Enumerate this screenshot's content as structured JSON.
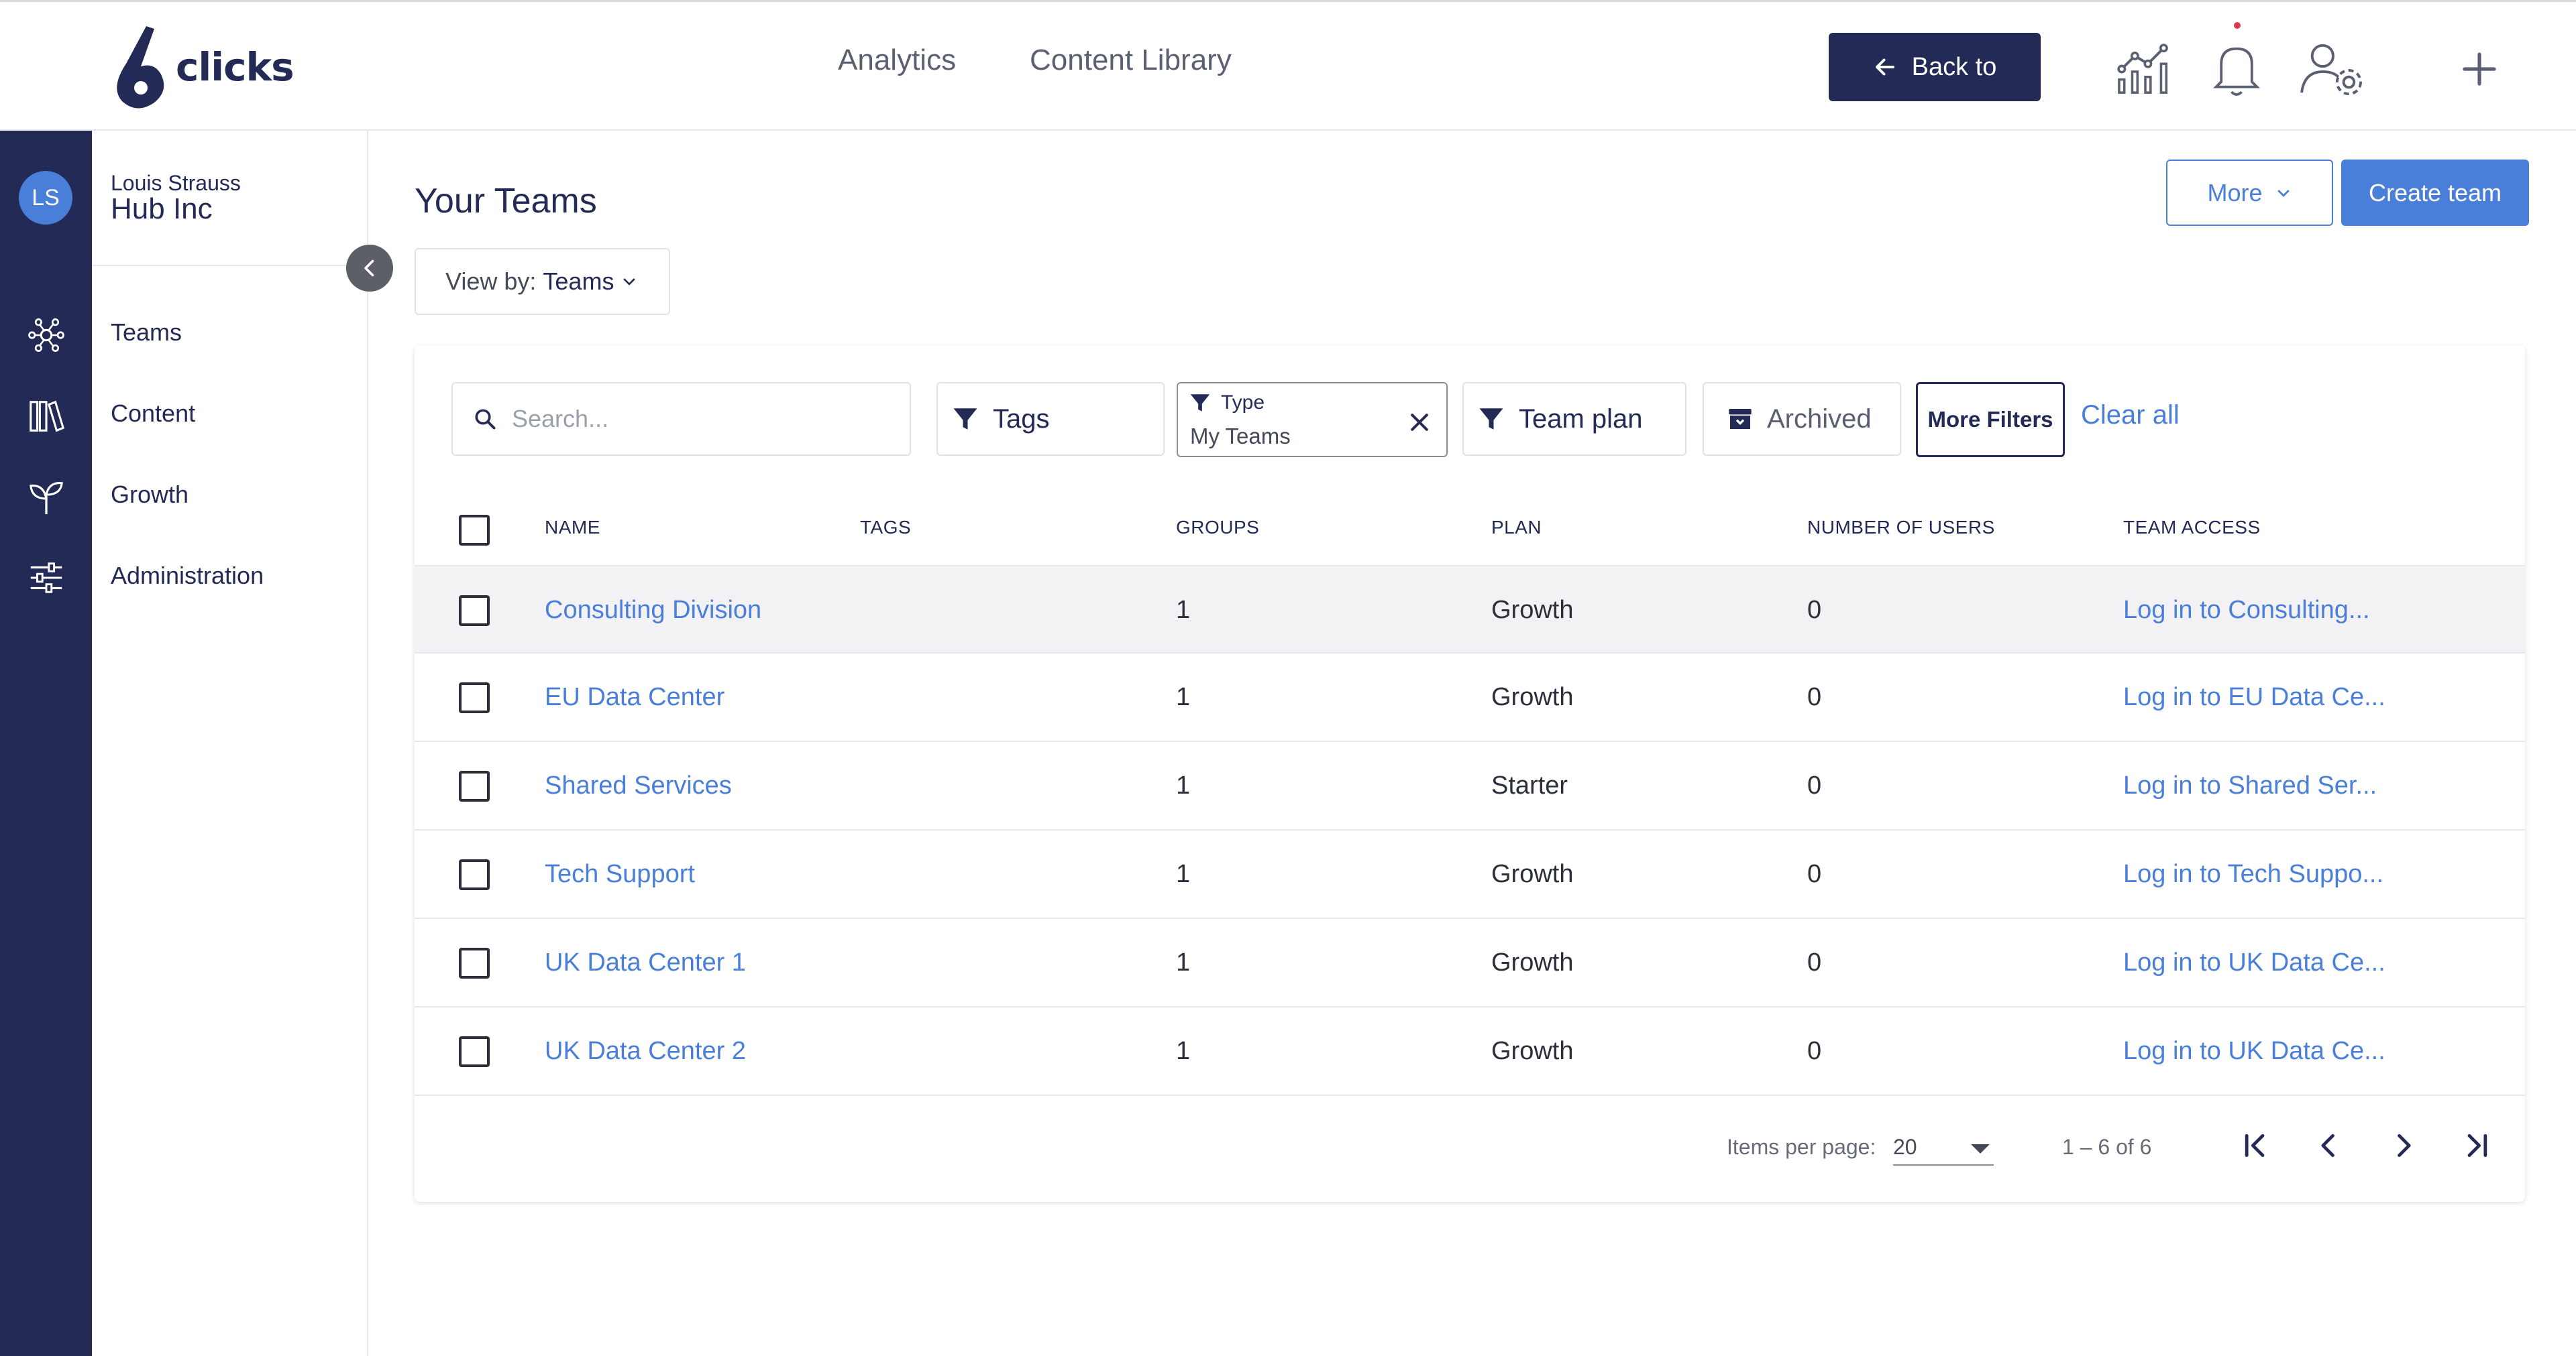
{
  "header": {
    "logo_text": "clicks",
    "nav": [
      "Analytics",
      "Content Library"
    ],
    "back_label": "Back to"
  },
  "rail": {
    "avatar_initials": "LS"
  },
  "sidepanel": {
    "user_name": "Louis Strauss",
    "org_name": "Hub Inc",
    "items": [
      "Teams",
      "Content",
      "Growth",
      "Administration"
    ]
  },
  "main": {
    "title": "Your Teams",
    "more_label": "More",
    "create_label": "Create team",
    "viewby_prefix": "View by:",
    "viewby_value": "Teams"
  },
  "filters": {
    "search_placeholder": "Search...",
    "tags_label": "Tags",
    "type_label": "Type",
    "type_value": "My Teams",
    "team_plan_label": "Team plan",
    "archived_label": "Archived",
    "more_filters_label": "More Filters",
    "clear_all_label": "Clear all"
  },
  "table": {
    "columns": [
      "NAME",
      "TAGS",
      "GROUPS",
      "PLAN",
      "NUMBER OF USERS",
      "TEAM ACCESS"
    ],
    "rows": [
      {
        "name": "Consulting Division",
        "tags": "",
        "groups": "1",
        "plan": "Growth",
        "users": "0",
        "access": "Log in to Consulting..."
      },
      {
        "name": "EU Data Center",
        "tags": "",
        "groups": "1",
        "plan": "Growth",
        "users": "0",
        "access": "Log in to EU Data Ce..."
      },
      {
        "name": "Shared Services",
        "tags": "",
        "groups": "1",
        "plan": "Starter",
        "users": "0",
        "access": "Log in to Shared Ser..."
      },
      {
        "name": "Tech Support",
        "tags": "",
        "groups": "1",
        "plan": "Growth",
        "users": "0",
        "access": "Log in to Tech Suppo..."
      },
      {
        "name": "UK Data Center 1",
        "tags": "",
        "groups": "1",
        "plan": "Growth",
        "users": "0",
        "access": "Log in to UK Data Ce..."
      },
      {
        "name": "UK Data Center 2",
        "tags": "",
        "groups": "1",
        "plan": "Growth",
        "users": "0",
        "access": "Log in to UK Data Ce..."
      }
    ]
  },
  "pagination": {
    "items_per_page_label": "Items per page:",
    "items_per_page": "20",
    "range": "1 – 6 of 6"
  },
  "colors": {
    "navy": "#222a55",
    "accent_blue": "#4a7fd9",
    "notification_dot": "#e0394b"
  }
}
